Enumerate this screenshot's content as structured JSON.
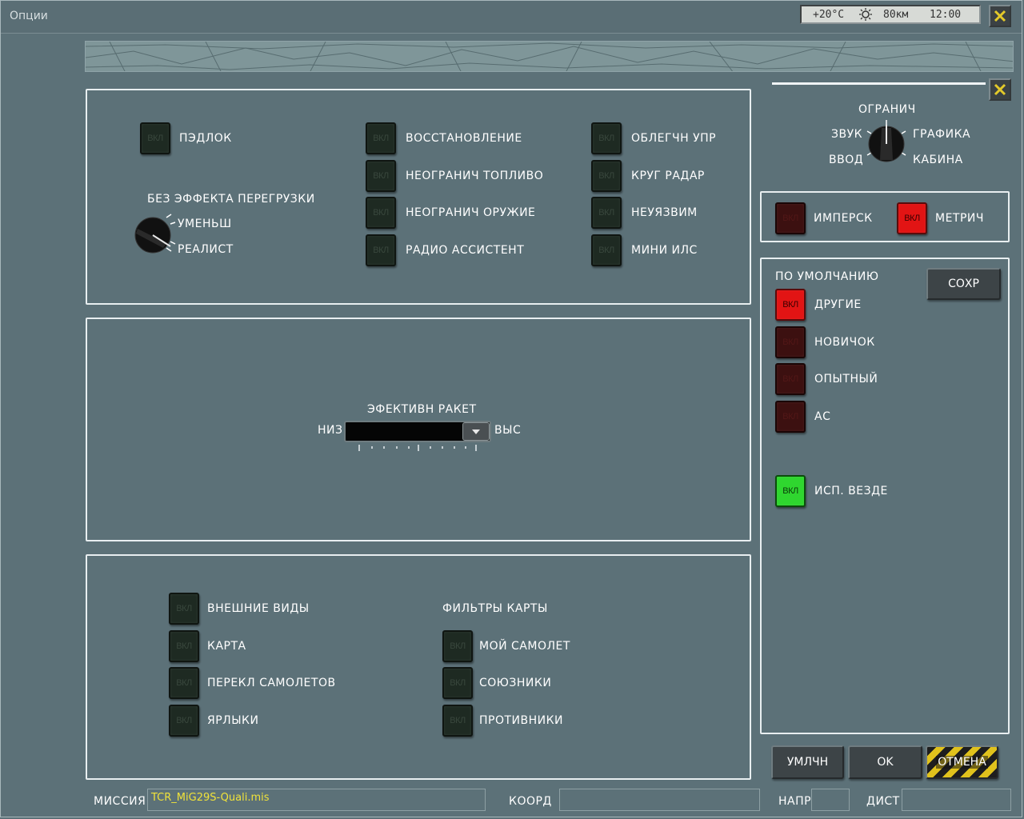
{
  "window": {
    "title": "Опции"
  },
  "weather": {
    "temp": "+20°C",
    "visibility": "80км",
    "time": "12:00"
  },
  "settings_panel": {
    "padlock": {
      "switch": "ВКЛ",
      "label": "ПЭДЛОК"
    },
    "g_effects": {
      "title": "БЕЗ ЭФФЕКТА ПЕРЕГРУЗКИ",
      "options": [
        "УМЕНЬШ",
        "РЕАЛИСТ"
      ]
    },
    "col2": [
      {
        "switch": "ВКЛ",
        "label": "ВОССТАНОВЛЕНИЕ"
      },
      {
        "switch": "ВКЛ",
        "label": "НЕОГРАНИЧ ТОПЛИВО"
      },
      {
        "switch": "ВКЛ",
        "label": "НЕОГРАНИЧ ОРУЖИЕ"
      },
      {
        "switch": "ВКЛ",
        "label": "РАДИО АССИСТЕНТ"
      }
    ],
    "col3": [
      {
        "switch": "ВКЛ",
        "label": "ОБЛЕГЧН УПР"
      },
      {
        "switch": "ВКЛ",
        "label": "КРУГ РАДАР"
      },
      {
        "switch": "ВКЛ",
        "label": "НЕУЯЗВИМ"
      },
      {
        "switch": "ВКЛ",
        "label": "МИНИ ИЛС"
      }
    ]
  },
  "missile_panel": {
    "title": "ЭФЕКТИВН РАКЕТ",
    "low": "НИЗ",
    "high": "ВЫС"
  },
  "views_panel": {
    "left": [
      {
        "switch": "ВКЛ",
        "label": "ВНЕШНИЕ ВИДЫ"
      },
      {
        "switch": "ВКЛ",
        "label": "КАРТА"
      },
      {
        "switch": "ВКЛ",
        "label": "ПЕРЕКЛ САМОЛЕТОВ"
      },
      {
        "switch": "ВКЛ",
        "label": "ЯРЛЫКИ"
      }
    ],
    "filters_title": "ФИЛЬТРЫ КАРТЫ",
    "filters": [
      {
        "switch": "ВКЛ",
        "label": "МОЙ САМОЛЕТ"
      },
      {
        "switch": "ВКЛ",
        "label": "СОЮЗНИКИ"
      },
      {
        "switch": "ВКЛ",
        "label": "ПРОТИВНИКИ"
      }
    ]
  },
  "category_selector": {
    "top": "ОГРАНИЧ",
    "left_upper": "ЗВУК",
    "right_upper": "ГРАФИКА",
    "left_lower": "ВВОД",
    "right_lower": "КАБИНА"
  },
  "units": [
    {
      "switch": "ВКЛ",
      "label": "ИМПЕРСК",
      "state": "off"
    },
    {
      "switch": "ВКЛ",
      "label": "МЕТРИЧ",
      "state": "on"
    }
  ],
  "presets": {
    "title": "ПО УМОЛЧАНИЮ",
    "save_label": "СОХР",
    "items": [
      {
        "switch": "ВКЛ",
        "label": "ДРУГИЕ",
        "state": "on"
      },
      {
        "switch": "ВКЛ",
        "label": "НОВИЧОК",
        "state": "off"
      },
      {
        "switch": "ВКЛ",
        "label": "ОПЫТНЫЙ",
        "state": "off"
      },
      {
        "switch": "ВКЛ",
        "label": "АС",
        "state": "off"
      }
    ],
    "use_everywhere": {
      "switch": "ВКЛ",
      "label": "ИСП. ВЕЗДЕ"
    }
  },
  "footer_buttons": {
    "default": "УМЛЧН",
    "ok": "OK",
    "cancel": "ОТМЕНА"
  },
  "status_bar": {
    "mission_label": "МИССИЯ",
    "mission_value": "TCR_MiG29S-Quali.mis",
    "coord_label": "КООРД",
    "coord_value": "",
    "heading_label": "НАПР",
    "heading_value": "",
    "distance_label": "ДИСТ",
    "distance_value": ""
  },
  "colors": {
    "background": "#5c7178",
    "switch_off": "#1e2a22",
    "switch_red": "#e21414",
    "switch_green": "#2fd62f",
    "mission_text": "#f0e23a"
  }
}
